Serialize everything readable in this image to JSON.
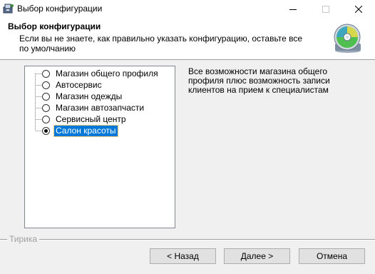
{
  "window": {
    "title": "Выбор конфигурации"
  },
  "header": {
    "title": "Выбор конфигурации",
    "description": "Если вы не знаете, как правильно указать конфигурацию, оставьте все по умолчанию"
  },
  "tree": {
    "items": [
      {
        "label": "Магазин общего профиля",
        "checked": false
      },
      {
        "label": "Автосервис",
        "checked": false
      },
      {
        "label": "Магазин одежды",
        "checked": false
      },
      {
        "label": "Магазин автозапчасти",
        "checked": false
      },
      {
        "label": "Сервисный центр",
        "checked": false
      },
      {
        "label": "Салон красоты",
        "checked": true
      }
    ]
  },
  "description": {
    "text": "Все возможности магазина общего профиля плюс возможность записи клиентов на прием к специалистам"
  },
  "footer": {
    "brand": "Тирика",
    "back_label": "< Назад",
    "next_label": "Далее >",
    "cancel_label": "Отмена"
  },
  "colors": {
    "selection": "#0078d7",
    "window_bg": "#f0f0f0",
    "header_bg": "#ffffff"
  },
  "icons": {
    "app": "installer-icon",
    "header": "cd-disc-icon"
  }
}
